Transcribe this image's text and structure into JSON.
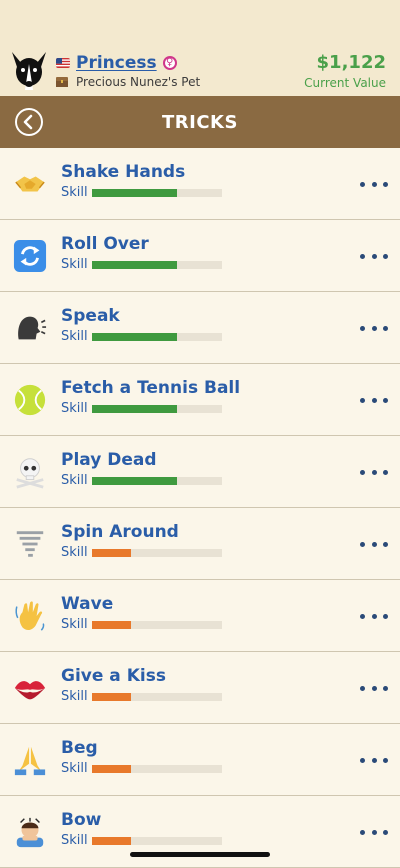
{
  "pet": {
    "name": "Princess",
    "subtitle": "Precious Nunez's Pet",
    "value": "$1,122",
    "value_label": "Current Value"
  },
  "nav": {
    "title": "TRICKS"
  },
  "colors": {
    "high": "#3f9a3f",
    "low": "#e8792b"
  },
  "tricks": [
    {
      "name": "Shake Hands",
      "skill_label": "Skill",
      "skill": 0.65,
      "level": "high",
      "icon": "handshake-icon"
    },
    {
      "name": "Roll Over",
      "skill_label": "Skill",
      "skill": 0.65,
      "level": "high",
      "icon": "repeat-arrows-icon"
    },
    {
      "name": "Speak",
      "skill_label": "Skill",
      "skill": 0.65,
      "level": "high",
      "icon": "speaking-head-icon"
    },
    {
      "name": "Fetch a Tennis Ball",
      "skill_label": "Skill",
      "skill": 0.65,
      "level": "high",
      "icon": "tennis-ball-icon"
    },
    {
      "name": "Play Dead",
      "skill_label": "Skill",
      "skill": 0.65,
      "level": "high",
      "icon": "skull-crossbones-icon"
    },
    {
      "name": "Spin Around",
      "skill_label": "Skill",
      "skill": 0.3,
      "level": "low",
      "icon": "tornado-icon"
    },
    {
      "name": "Wave",
      "skill_label": "Skill",
      "skill": 0.3,
      "level": "low",
      "icon": "waving-hand-icon"
    },
    {
      "name": "Give a Kiss",
      "skill_label": "Skill",
      "skill": 0.3,
      "level": "low",
      "icon": "kiss-mark-icon"
    },
    {
      "name": "Beg",
      "skill_label": "Skill",
      "skill": 0.3,
      "level": "low",
      "icon": "folded-hands-icon"
    },
    {
      "name": "Bow",
      "skill_label": "Skill",
      "skill": 0.3,
      "level": "low",
      "icon": "bowing-person-icon"
    }
  ]
}
